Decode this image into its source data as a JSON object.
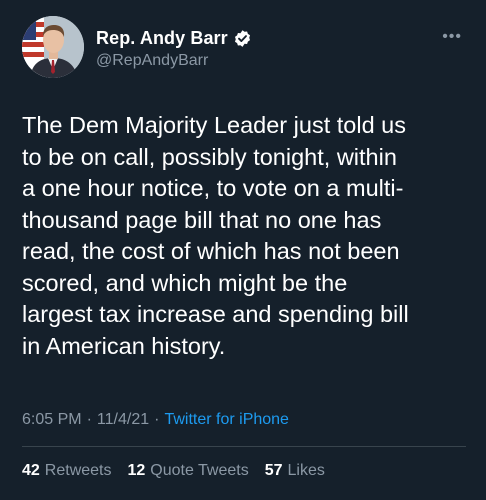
{
  "tweet": {
    "author": {
      "display_name": "Rep. Andy Barr",
      "handle": "@RepAndyBarr",
      "verified": true
    },
    "more_icon": "more-horizontal-icon",
    "text": "The Dem Majority Leader just told us\nto be on call, possibly tonight, within\na one hour notice, to vote on a multi-\nthousand page bill that no one has\nread, the cost of which has not been\nscored, and which might be the\nlargest tax increase and spending bill\nin American history.",
    "time": "6:05 PM",
    "date": "11/4/21",
    "separator": "·",
    "source": "Twitter for iPhone",
    "stats": {
      "retweets_count": "42",
      "retweets_label": "Retweets",
      "quotes_count": "12",
      "quotes_label": "Quote Tweets",
      "likes_count": "57",
      "likes_label": "Likes"
    }
  },
  "colors": {
    "background": "#15202b",
    "text_primary": "#ffffff",
    "text_secondary": "#8b98a5",
    "link": "#1d9bf0",
    "divider": "#38444d"
  }
}
